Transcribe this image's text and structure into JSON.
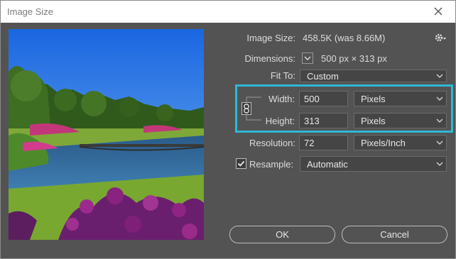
{
  "window": {
    "title": "Image Size"
  },
  "info": {
    "image_size_label": "Image Size:",
    "image_size_value": "458.5K (was 8.66M)",
    "dimensions_label": "Dimensions:",
    "dimensions_value": "500 px  ×  313 px",
    "fit_to_label": "Fit To:",
    "fit_to_value": "Custom"
  },
  "size": {
    "width_label": "Width:",
    "width_value": "500",
    "width_unit": "Pixels",
    "height_label": "Height:",
    "height_value": "313",
    "height_unit": "Pixels"
  },
  "resolution": {
    "label": "Resolution:",
    "value": "72",
    "unit": "Pixels/Inch"
  },
  "resample": {
    "label": "Resample:",
    "checked": true,
    "method": "Automatic"
  },
  "buttons": {
    "ok": "OK",
    "cancel": "Cancel"
  },
  "colors": {
    "highlight": "#2eb8d6",
    "panel": "#535353",
    "field": "#454545"
  }
}
